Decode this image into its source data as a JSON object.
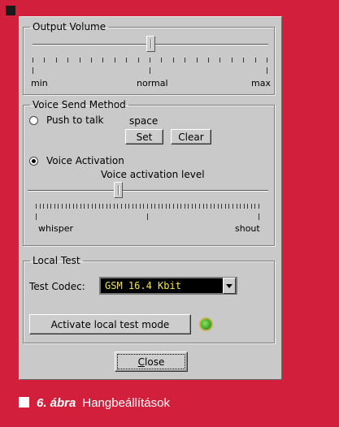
{
  "output_volume": {
    "legend": "Output Volume",
    "level_fraction": 0.5,
    "labels": {
      "min": "min",
      "normal": "normal",
      "max": "max"
    }
  },
  "voice_send": {
    "legend": "Voice Send Method",
    "push_to_talk_label": "Push to talk",
    "push_to_talk_key": "space",
    "set_button": "Set",
    "clear_button": "Clear",
    "voice_activation_label": "Voice Activation",
    "selected": "voice_activation",
    "activation_level_title": "Voice activation level",
    "activation_level_fraction": 0.375,
    "labels": {
      "low": "whisper",
      "high": "shout"
    }
  },
  "local_test": {
    "legend": "Local Test",
    "codec_label": "Test Codec:",
    "codec_value": "GSM 16.4 Kbit",
    "activate_button": "Activate local test mode",
    "status_led_color": "#2e9c22"
  },
  "footer": {
    "close_button": "Close"
  },
  "caption": {
    "number": "6. ábra",
    "text": "Hangbeállítások"
  },
  "colors": {
    "page_background": "#d21f3c",
    "dialog_background": "#c9c9c9",
    "combo_text": "#f2e44a"
  }
}
